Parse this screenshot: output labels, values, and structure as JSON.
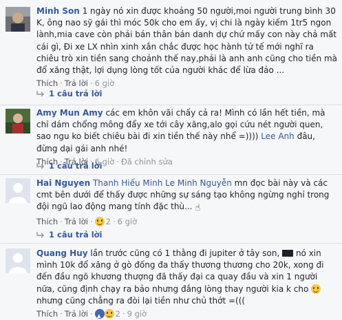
{
  "comments": [
    {
      "author": "Minh Son",
      "text": "1 ngày nó xin được khoảng 50 người,moi người trung bình 30 K, ông nao sỹ gái thì móc 50k cho em ấy, vị chi là ngày kiếm 1tr5 ngon lành,mia cave còn phải bán thân bán danh dự chứ mấy con này chả mất cái gì, Đi xe LX nhìn xinh xắn chắc được học hành tử tế mới nghĩ ra chiêu trò xin tiền sang choảnh thế nay,phải là anh anh cũng cho tiền mà đổ xăng thật, lợi dụng lòng tốt của người khác để lừa đảo ...",
      "like_label": "Thích",
      "reply_label": "Trả lời",
      "time": "6 giờ",
      "replies_label": "1 câu trả lời"
    },
    {
      "author": "Amy Mun Amy",
      "text_1": "các em khôn vãi chấy cả ra! Mình có lần hết tiền, mà chỉ dám chổng mông đẩy xe tới cây xăng,alo gọi cứu nét người quen, sao ngu ko biết chiêu bài đi xin tiền thế này nhể =))))",
      "mention": "Lee Anh",
      "text_2": "đâu, đừng dại gái anh nhé!",
      "like_label": "Thích",
      "reply_label": "Trả lời",
      "time": "6 giờ",
      "edited_label": "Đã chỉnh sửa",
      "replies_label": "1 câu trả lời"
    },
    {
      "author": "Hai Nguyen",
      "mention_1": "Thanh Hiếu Minh",
      "mention_2": "Le Minh Nguyễn",
      "text": "mn đọc bài này và các cmt bên dưới để thấy được những sự sáng tạo không ngừng nghỉ trong đội ngũ lao động mang tính đặc thù...",
      "like_label": "Thích",
      "reply_label": "Trả lời",
      "reaction_count": "2",
      "time": "6 giờ",
      "replies_label": "1 câu trả lời"
    },
    {
      "author": "Quang Huy",
      "text_1": "lần trước cũng có 1 thằng đi jupiter ở tây son,",
      "text_2": "nó xin mình 10k đổ xăng ở gò đống đa thấy thương thương cho 20k, xong đi đến đầu ngõ khương thượng đã thấy đại ca quay đầu và xin 1 người nữa, cũng định chạy ra bảo nhưng đắng lòng thay người kia k cho",
      "text_3": "nhưng cũng chẳng ra đòi lại tiền như chủ thớt =(((",
      "like_label": "Thích",
      "reply_label": "Trả lời",
      "reaction_count": "2",
      "time": "9 giờ"
    }
  ]
}
